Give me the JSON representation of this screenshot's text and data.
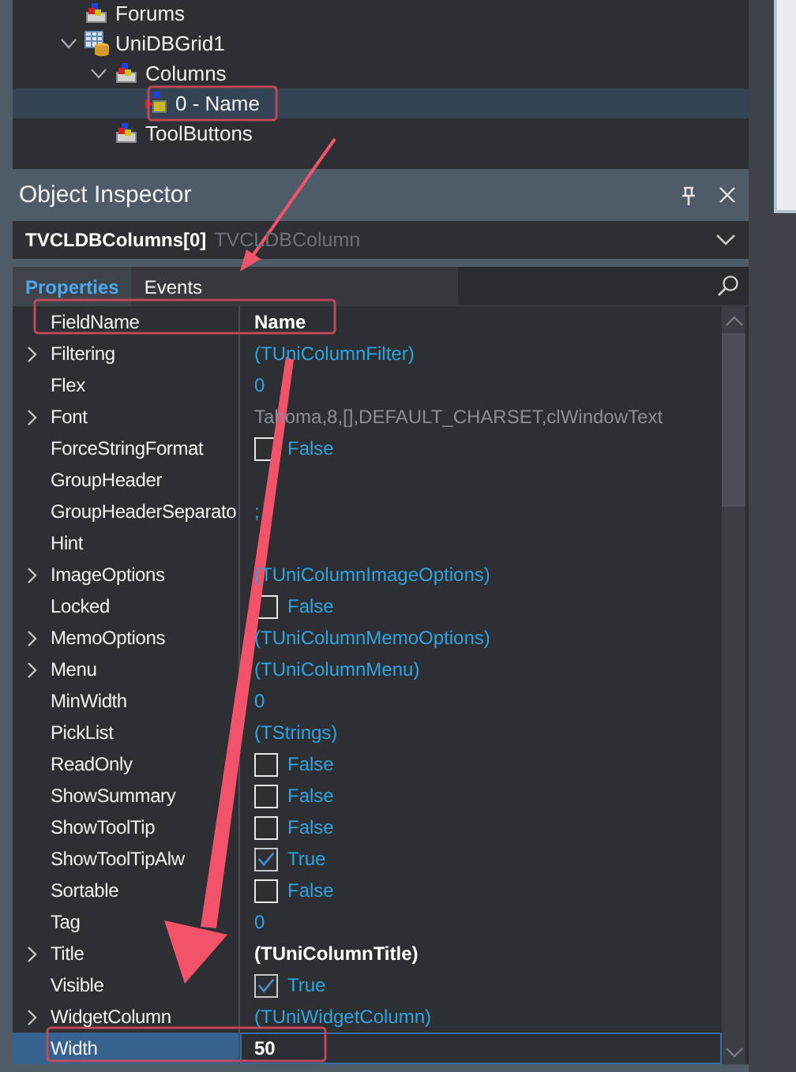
{
  "tree": [
    {
      "label": "Forums",
      "kind": "component",
      "selected": false
    },
    {
      "label": "UniDBGrid1",
      "kind": "grid",
      "expanded": true,
      "selected": false,
      "children": [
        {
          "label": "Columns",
          "kind": "component",
          "expanded": true,
          "selected": false,
          "children": [
            {
              "label": "0 - Name",
              "kind": "column",
              "selected": true
            }
          ]
        },
        {
          "label": "ToolButtons",
          "kind": "component",
          "selected": false
        }
      ]
    }
  ],
  "inspector": {
    "title": "Object Inspector",
    "object": {
      "name": "TVCLDBColumns[0]",
      "type": "TVCLDBColumn"
    },
    "tabs": [
      {
        "label": "Properties",
        "selected": true
      },
      {
        "label": "Events",
        "selected": false
      }
    ],
    "properties": [
      {
        "name": "FieldName",
        "kind": "bold",
        "value": "Name",
        "expandable": false,
        "selected": false
      },
      {
        "name": "Filtering",
        "kind": "link",
        "value": "(TUniColumnFilter)",
        "expandable": true,
        "selected": false
      },
      {
        "name": "Flex",
        "kind": "link",
        "value": "0",
        "expandable": false,
        "selected": false
      },
      {
        "name": "Font",
        "kind": "dark",
        "value": "Tahoma,8,[],DEFAULT_CHARSET,clWindowText",
        "expandable": true,
        "selected": false
      },
      {
        "name": "ForceStringFormat",
        "kind": "bool",
        "value": "False",
        "checked": false,
        "expandable": false,
        "selected": false
      },
      {
        "name": "GroupHeader",
        "kind": "empty",
        "expandable": false,
        "selected": false
      },
      {
        "name": "GroupHeaderSeparato",
        "kind": "link",
        "value": ";",
        "expandable": false,
        "selected": false
      },
      {
        "name": "Hint",
        "kind": "empty",
        "expandable": false,
        "selected": false
      },
      {
        "name": "ImageOptions",
        "kind": "link",
        "value": "(TUniColumnImageOptions)",
        "expandable": true,
        "selected": false
      },
      {
        "name": "Locked",
        "kind": "bool",
        "value": "False",
        "checked": false,
        "expandable": false,
        "selected": false
      },
      {
        "name": "MemoOptions",
        "kind": "link",
        "value": "(TUniColumnMemoOptions)",
        "expandable": true,
        "selected": false
      },
      {
        "name": "Menu",
        "kind": "link",
        "value": "(TUniColumnMenu)",
        "expandable": true,
        "selected": false
      },
      {
        "name": "MinWidth",
        "kind": "link",
        "value": "0",
        "expandable": false,
        "selected": false
      },
      {
        "name": "PickList",
        "kind": "link",
        "value": "(TStrings)",
        "expandable": false,
        "selected": false
      },
      {
        "name": "ReadOnly",
        "kind": "bool",
        "value": "False",
        "checked": false,
        "expandable": false,
        "selected": false
      },
      {
        "name": "ShowSummary",
        "kind": "bool",
        "value": "False",
        "checked": false,
        "expandable": false,
        "selected": false
      },
      {
        "name": "ShowToolTip",
        "kind": "bool",
        "value": "False",
        "checked": false,
        "expandable": false,
        "selected": false
      },
      {
        "name": "ShowToolTipAlw",
        "kind": "bool",
        "value": "True",
        "checked": true,
        "expandable": false,
        "selected": false
      },
      {
        "name": "Sortable",
        "kind": "bool",
        "value": "False",
        "checked": false,
        "expandable": false,
        "selected": false
      },
      {
        "name": "Tag",
        "kind": "link",
        "value": "0",
        "expandable": false,
        "selected": false
      },
      {
        "name": "Title",
        "kind": "bold",
        "value": "(TUniColumnTitle)",
        "expandable": true,
        "selected": false
      },
      {
        "name": "Visible",
        "kind": "bool",
        "value": "True",
        "checked": true,
        "expandable": false,
        "selected": false
      },
      {
        "name": "WidgetColumn",
        "kind": "link",
        "value": "(TUniWidgetColumn)",
        "expandable": true,
        "selected": false
      },
      {
        "name": "Width",
        "kind": "bold",
        "value": "50",
        "expandable": false,
        "selected": true
      }
    ]
  }
}
